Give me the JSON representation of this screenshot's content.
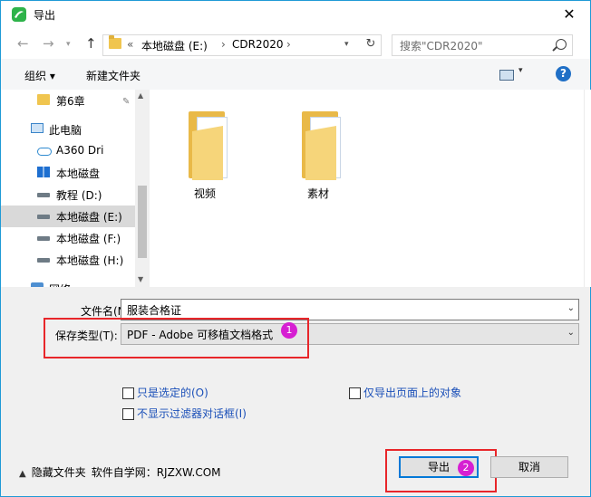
{
  "window": {
    "title": "导出",
    "close_label": "✕"
  },
  "nav": {
    "back_label": "←",
    "forward_label": "→",
    "up_label": "↑",
    "path_separator": "«",
    "breadcrumb": [
      "本地磁盘 (E:)",
      "CDR2020"
    ],
    "crumb_sep": "›",
    "refresh_label": "↻",
    "search_placeholder": "搜索\"CDR2020\""
  },
  "toolbar": {
    "organize_label": "组织 ▾",
    "new_folder_label": "新建文件夹",
    "view_caret": "▾",
    "help_label": "?"
  },
  "sidebar": {
    "items": [
      {
        "label": "第6章",
        "icon": "folder-icon"
      },
      {
        "label": "此电脑",
        "icon": "computer-icon"
      },
      {
        "label": "A360 Dri",
        "icon": "cloud-drive-icon"
      },
      {
        "label": "本地磁盘",
        "icon": "windows-drive-icon"
      },
      {
        "label": "教程 (D:)",
        "icon": "drive-icon"
      },
      {
        "label": "本地磁盘 (E:)",
        "icon": "drive-icon"
      },
      {
        "label": "本地磁盘 (F:)",
        "icon": "drive-icon"
      },
      {
        "label": "本地磁盘 (H:)",
        "icon": "drive-icon"
      },
      {
        "label": "网络",
        "icon": "network-icon"
      }
    ],
    "selected": "本地磁盘 (E:)",
    "pin_label": "📌"
  },
  "folders": [
    {
      "label": "视频"
    },
    {
      "label": "素材"
    }
  ],
  "form": {
    "filename_label": "文件名(N):",
    "filename_value": "服装合格证",
    "filetype_label": "保存类型(T):",
    "filetype_value": "PDF - Adobe 可移植文档格式",
    "dropdown_caret": "⌄"
  },
  "options": {
    "selected_only": "只是选定的(O)",
    "export_page_objects": "仅导出页面上的对象",
    "no_filter_dialog": "不显示过滤器对话框(I)"
  },
  "footer": {
    "hide_folders_caret": "▲",
    "hide_folders": "隐藏文件夹",
    "watermark": "软件自学网：RJZXW.COM",
    "export_button": "导出",
    "cancel_button": "取消"
  },
  "annotations": {
    "badge_1": "1",
    "badge_2": "2"
  },
  "colors": {
    "accent": "#0078d7",
    "highlight_red": "#e8262a",
    "badge_magenta": "#d61fd2"
  }
}
